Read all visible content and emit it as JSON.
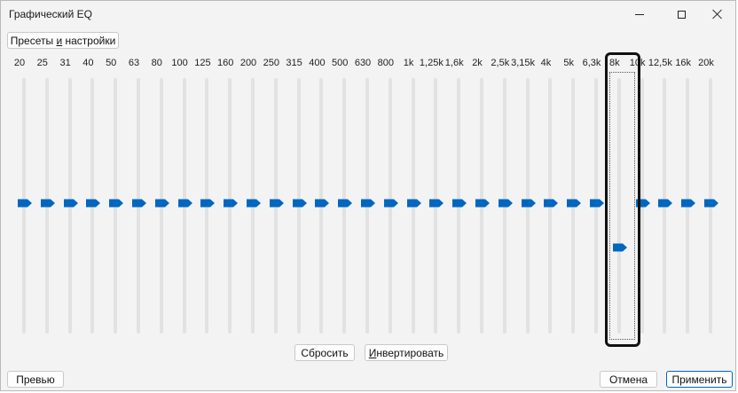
{
  "window": {
    "title": "Графический EQ"
  },
  "toolbar": {
    "presets_label_pre": "Пресеты ",
    "presets_label_mnemonic": "и",
    "presets_label_post": " настройки"
  },
  "bands": [
    {
      "label": "20",
      "gain": 0
    },
    {
      "label": "25",
      "gain": 0
    },
    {
      "label": "31",
      "gain": 0
    },
    {
      "label": "40",
      "gain": 0
    },
    {
      "label": "50",
      "gain": 0
    },
    {
      "label": "63",
      "gain": 0
    },
    {
      "label": "80",
      "gain": 0
    },
    {
      "label": "100",
      "gain": 0
    },
    {
      "label": "125",
      "gain": 0
    },
    {
      "label": "160",
      "gain": 0
    },
    {
      "label": "200",
      "gain": 0
    },
    {
      "label": "250",
      "gain": 0
    },
    {
      "label": "315",
      "gain": 0
    },
    {
      "label": "400",
      "gain": 0
    },
    {
      "label": "500",
      "gain": 0
    },
    {
      "label": "630",
      "gain": 0
    },
    {
      "label": "800",
      "gain": 0
    },
    {
      "label": "1k",
      "gain": 0
    },
    {
      "label": "1,25k",
      "gain": 0
    },
    {
      "label": "1,6k",
      "gain": 0
    },
    {
      "label": "2k",
      "gain": 0
    },
    {
      "label": "2,5k",
      "gain": 0
    },
    {
      "label": "3,15k",
      "gain": 0
    },
    {
      "label": "4k",
      "gain": 0
    },
    {
      "label": "5k",
      "gain": 0
    },
    {
      "label": "6,3k",
      "gain": 0
    },
    {
      "label": "8k",
      "gain": -0.35,
      "focused": true
    },
    {
      "label": "10k",
      "gain": 0
    },
    {
      "label": "12,5k",
      "gain": 0
    },
    {
      "label": "16k",
      "gain": 0
    },
    {
      "label": "20k",
      "gain": 0
    }
  ],
  "actions": {
    "reset_label": "Сбросить",
    "invert_label_mnemonic": "И",
    "invert_label_post": "нвертировать"
  },
  "footer": {
    "preview_label": "Превью",
    "cancel_label": "Отмена",
    "apply_label": "Применить"
  },
  "colors": {
    "accent": "#0067c0",
    "track": "#e2e2e2",
    "background": "#f3f3f3"
  }
}
